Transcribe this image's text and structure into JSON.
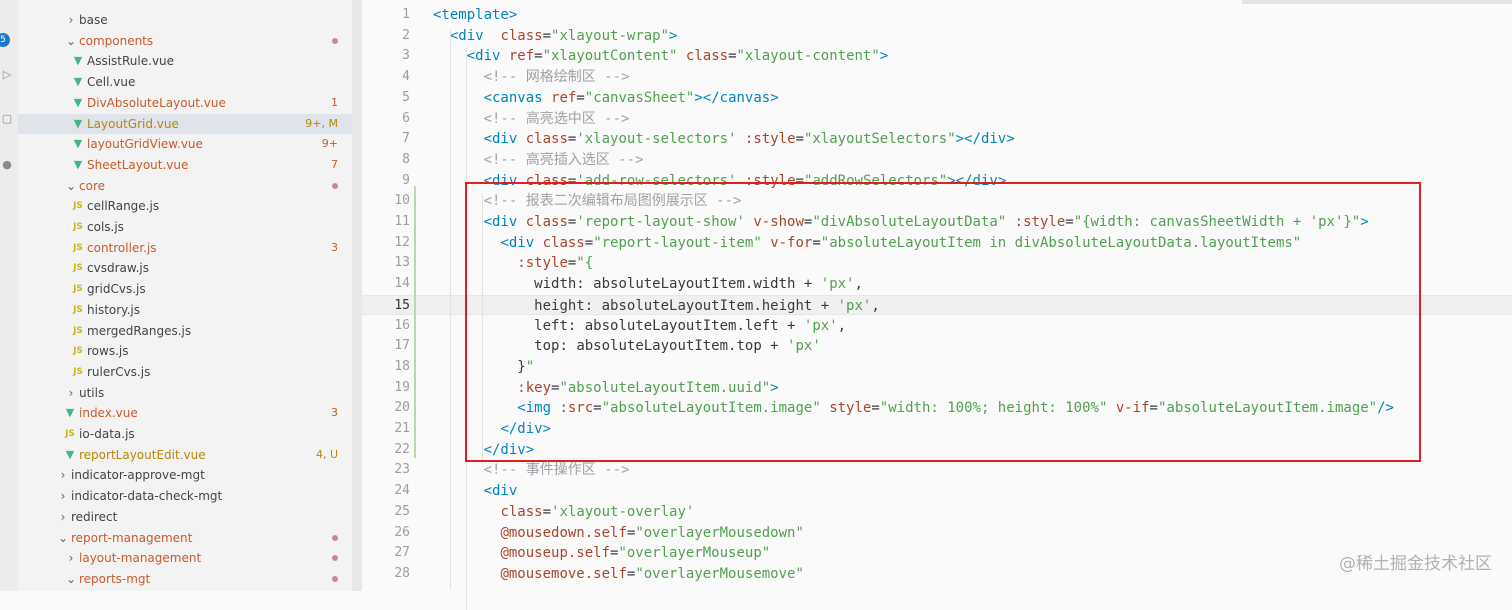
{
  "explorer": {
    "items": [
      {
        "label": "base",
        "type": "folder",
        "depth": 1,
        "open": false
      },
      {
        "label": "components",
        "type": "folder",
        "depth": 1,
        "open": true,
        "color": "#c85b2b",
        "dot": true
      },
      {
        "label": "AssistRule.vue",
        "type": "vue",
        "depth": 2
      },
      {
        "label": "Cell.vue",
        "type": "vue",
        "depth": 2
      },
      {
        "label": "DivAbsoluteLayout.vue",
        "type": "vue",
        "depth": 2,
        "color": "#c85b2b",
        "badge": "1"
      },
      {
        "label": "LayoutGrid.vue",
        "type": "vue",
        "depth": 2,
        "color": "#b8860b",
        "badge": "9+, M",
        "selected": true
      },
      {
        "label": "layoutGridView.vue",
        "type": "vue",
        "depth": 2,
        "color": "#c85b2b",
        "badge": "9+"
      },
      {
        "label": "SheetLayout.vue",
        "type": "vue",
        "depth": 2,
        "color": "#c85b2b",
        "badge": "7"
      },
      {
        "label": "core",
        "type": "folder",
        "depth": 1,
        "open": true,
        "color": "#c85b2b",
        "dot": true
      },
      {
        "label": "cellRange.js",
        "type": "js",
        "depth": 2
      },
      {
        "label": "cols.js",
        "type": "js",
        "depth": 2
      },
      {
        "label": "controller.js",
        "type": "js",
        "depth": 2,
        "color": "#c85b2b",
        "badge": "3"
      },
      {
        "label": "cvsdraw.js",
        "type": "js",
        "depth": 2
      },
      {
        "label": "gridCvs.js",
        "type": "js",
        "depth": 2
      },
      {
        "label": "history.js",
        "type": "js",
        "depth": 2
      },
      {
        "label": "mergedRanges.js",
        "type": "js",
        "depth": 2
      },
      {
        "label": "rows.js",
        "type": "js",
        "depth": 2
      },
      {
        "label": "rulerCvs.js",
        "type": "js",
        "depth": 2
      },
      {
        "label": "utils",
        "type": "folder",
        "depth": 1,
        "open": false
      },
      {
        "label": "index.vue",
        "type": "vue",
        "depth": 1,
        "color": "#c85b2b",
        "badge": "3"
      },
      {
        "label": "io-data.js",
        "type": "js",
        "depth": 1
      },
      {
        "label": "reportLayoutEdit.vue",
        "type": "vue",
        "depth": 1,
        "color": "#b8860b",
        "badge": "4, U"
      },
      {
        "label": "indicator-approve-mgt",
        "type": "folder",
        "depth": 0,
        "open": false
      },
      {
        "label": "indicator-data-check-mgt",
        "type": "folder",
        "depth": 0,
        "open": false
      },
      {
        "label": "redirect",
        "type": "folder",
        "depth": 0,
        "open": false
      },
      {
        "label": "report-management",
        "type": "folder",
        "depth": 0,
        "open": true,
        "color": "#c85b2b",
        "dot": true
      },
      {
        "label": "layout-management",
        "type": "folder",
        "depth": 1,
        "open": false,
        "color": "#c85b2b",
        "dot": true
      },
      {
        "label": "reports-mgt",
        "type": "folder",
        "depth": 1,
        "open": true,
        "color": "#c85b2b",
        "dot": true
      }
    ]
  },
  "editor": {
    "current_line": 15,
    "lines": [
      {
        "n": "1",
        "code": "<template>"
      },
      {
        "n": "2",
        "code": "  <div  class=\"xlayout-wrap\">"
      },
      {
        "n": "3",
        "code": "    <div ref=\"xlayoutContent\" class=\"xlayout-content\">"
      },
      {
        "n": "4",
        "code": "      <!-- 网格绘制区 -->"
      },
      {
        "n": "5",
        "code": "      <canvas ref=\"canvasSheet\"></canvas>"
      },
      {
        "n": "6",
        "code": "      <!-- 高亮选中区 -->"
      },
      {
        "n": "7",
        "code": "      <div class='xlayout-selectors' :style=\"xlayoutSelectors\"></div>"
      },
      {
        "n": "8",
        "code": "      <!-- 高亮插入选区 -->"
      },
      {
        "n": "9",
        "code": "      <div class='add-row-selectors' :style=\"addRowSelectors\"></div>"
      },
      {
        "n": "10",
        "code": "      <!-- 报表二次编辑布局图例展示区 -->"
      },
      {
        "n": "11",
        "code": "      <div class='report-layout-show' v-show=\"divAbsoluteLayoutData\" :style=\"{width: canvasSheetWidth + 'px'}\">"
      },
      {
        "n": "12",
        "code": "        <div class=\"report-layout-item\" v-for=\"absoluteLayoutItem in divAbsoluteLayoutData.layoutItems\""
      },
      {
        "n": "13",
        "code": "          :style=\"{"
      },
      {
        "n": "14",
        "code": "            width: absoluteLayoutItem.width + 'px',"
      },
      {
        "n": "15",
        "code": "            height: absoluteLayoutItem.height + 'px',"
      },
      {
        "n": "16",
        "code": "            left: absoluteLayoutItem.left + 'px',"
      },
      {
        "n": "17",
        "code": "            top: absoluteLayoutItem.top + 'px'"
      },
      {
        "n": "18",
        "code": "          }\""
      },
      {
        "n": "19",
        "code": "          :key=\"absoluteLayoutItem.uuid\">"
      },
      {
        "n": "20",
        "code": "          <img :src=\"absoluteLayoutItem.image\" style=\"width: 100%; height: 100%\" v-if=\"absoluteLayoutItem.image\"/>"
      },
      {
        "n": "21",
        "code": "        </div>"
      },
      {
        "n": "22",
        "code": "      </div>"
      },
      {
        "n": "23",
        "code": "      <!-- 事件操作区 -->"
      },
      {
        "n": "24",
        "code": "      <div"
      },
      {
        "n": "25",
        "code": "        class='xlayout-overlay'"
      },
      {
        "n": "26",
        "code": "        @mousedown.self=\"overlayerMousedown\""
      },
      {
        "n": "27",
        "code": "        @mouseup.self=\"overlayerMouseup\""
      },
      {
        "n": "28",
        "code": "        @mousemove.self=\"overlayerMousemove\""
      }
    ]
  },
  "watermark": "@稀土掘金技术社区",
  "activity": {
    "badge": "5"
  },
  "colors": {
    "highlight_box": "#e02020",
    "vue_icon": "#41b883",
    "js_icon": "#cbb61c",
    "modified": "#c85b2b"
  }
}
